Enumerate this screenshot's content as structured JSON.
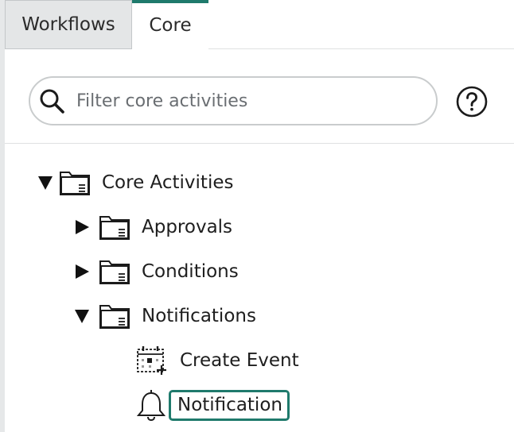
{
  "tabs": [
    {
      "label": "Workflows",
      "active": false
    },
    {
      "label": "Core",
      "active": true
    }
  ],
  "search": {
    "placeholder": "Filter core activities",
    "value": ""
  },
  "help": {
    "icon": "help-circle-icon"
  },
  "colors": {
    "accent": "#1f7a6c",
    "inactive_tab": "#e4e6e7",
    "border": "#c9cccd"
  },
  "tree": {
    "root": {
      "label": "Core Activities",
      "expanded": true,
      "icon": "folder-icon"
    },
    "children": [
      {
        "label": "Approvals",
        "expanded": false,
        "icon": "folder-icon"
      },
      {
        "label": "Conditions",
        "expanded": false,
        "icon": "folder-icon"
      },
      {
        "label": "Notifications",
        "expanded": true,
        "icon": "folder-icon",
        "children": [
          {
            "label": "Create Event",
            "icon": "calendar-add-icon",
            "selected": false
          },
          {
            "label": "Notification",
            "icon": "bell-icon",
            "selected": true
          }
        ]
      }
    ]
  }
}
